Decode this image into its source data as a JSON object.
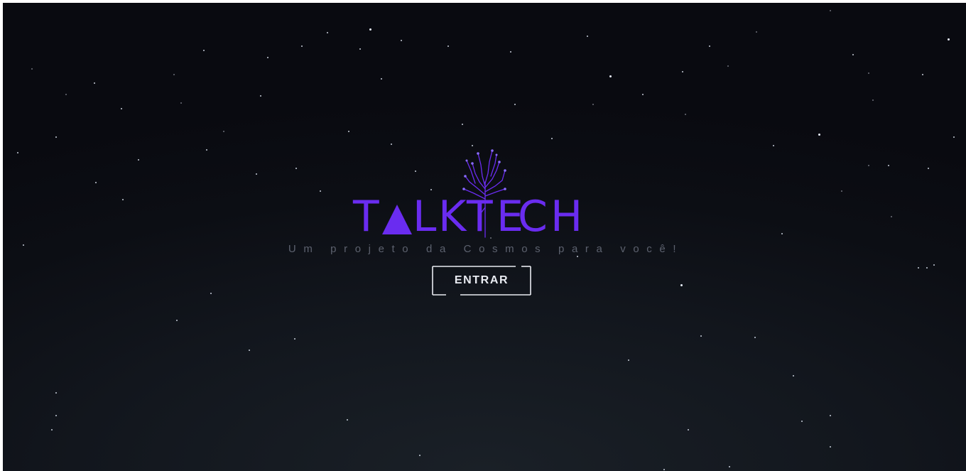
{
  "hero": {
    "logo": {
      "text": "TALK TECH",
      "color": "#6a2cf0",
      "icon_triangle": "triangle-a-icon",
      "icon_tree": "circuit-tree-icon"
    },
    "tagline": "Um projeto da Cosmos para você!",
    "enter_button": {
      "label": "ENTRAR"
    }
  },
  "theme": {
    "background": "#0c0e14",
    "accent": "#6a2cf0",
    "star_color": "#e8eefc",
    "tagline_color": "#5c616e",
    "button_color": "#e9ecf2"
  }
}
